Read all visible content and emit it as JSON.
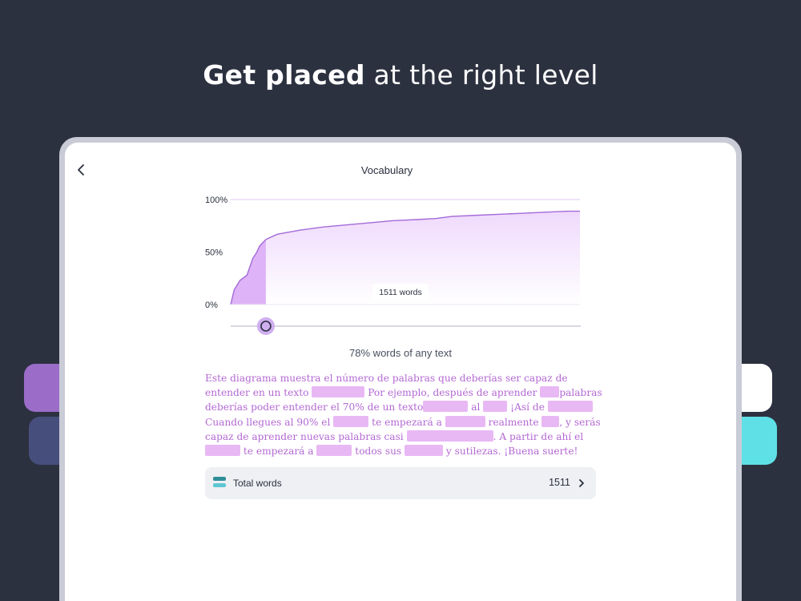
{
  "headline": {
    "bold": "Get placed",
    "rest": " at the right level"
  },
  "screen": {
    "title": "Vocabulary",
    "back_icon": "chevron-left-icon"
  },
  "chart_data": {
    "type": "area",
    "title": "",
    "xlabel": "",
    "ylabel": "",
    "y_tick_labels": [
      "100%",
      "50%",
      "0%"
    ],
    "ylim": [
      0,
      100
    ],
    "xlim": [
      0,
      15000
    ],
    "x": [
      0,
      150,
      400,
      700,
      950,
      1100,
      1250,
      1511,
      2000,
      3000,
      4000,
      5000,
      6000,
      7000,
      8000,
      8800,
      9500,
      10500,
      11500,
      12500,
      13500,
      14500,
      15000
    ],
    "values": [
      0,
      14,
      23,
      28,
      44,
      49,
      56,
      62,
      67,
      71,
      74,
      76,
      78,
      80,
      81,
      82,
      84,
      85,
      86,
      87,
      88,
      89,
      89
    ],
    "highlight_until_x": 1511,
    "tooltip": "1511 words",
    "slider_value": 1511,
    "colors": {
      "line": "#a46ad8",
      "highlight_fill": "#deb3f7",
      "fill_top": "#efd9fc",
      "slider": "#cfaef0"
    }
  },
  "caption": "78% words of any text",
  "description": {
    "lines": [
      [
        {
          "t": "Este diagrama muestra el número de palabras que deberías ser capaz de"
        }
      ],
      [
        {
          "t": "entender en un texto "
        },
        {
          "blank": 66
        },
        {
          "t": " Por ejemplo, después de aprender "
        },
        {
          "blank": 24
        },
        {
          "t": "palabras"
        }
      ],
      [
        {
          "t": "deberías poder entender el 70% de un texto"
        },
        {
          "blank": 56
        },
        {
          "t": " al "
        },
        {
          "blank": 30
        },
        {
          "t": " ¡Así de "
        },
        {
          "blank": 56
        }
      ],
      [
        {
          "t": "Cuando llegues al 90% el "
        },
        {
          "blank": 44
        },
        {
          "t": " te empezará a "
        },
        {
          "blank": 50
        },
        {
          "t": " realmente "
        },
        {
          "blank": 22
        },
        {
          "t": ", y serás"
        }
      ],
      [
        {
          "t": "capaz de aprender nuevas palabras casi "
        },
        {
          "blank": 108
        },
        {
          "t": ". A partir de ahí el"
        }
      ],
      [
        {
          "blank": 44
        },
        {
          "t": " te empezará a "
        },
        {
          "blank": 44
        },
        {
          "t": " todos sus "
        },
        {
          "blank": 48
        },
        {
          "t": " y sutilezas. ¡Buena suerte!"
        }
      ]
    ]
  },
  "total": {
    "label": "Total words",
    "count": "1511",
    "icon": "stack-icon",
    "chevron": "chevron-right-icon"
  }
}
